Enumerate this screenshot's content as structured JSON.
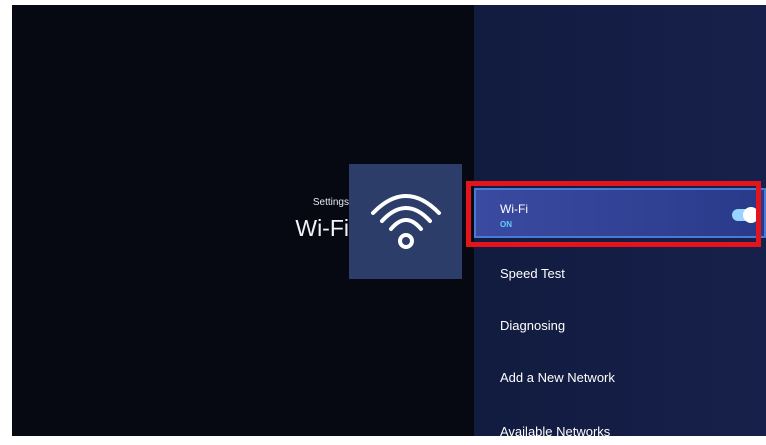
{
  "header": {
    "breadcrumb": "Settings",
    "title": "Wi-Fi"
  },
  "menu": {
    "items": [
      {
        "label": "Wi-Fi",
        "status": "ON",
        "selected": true,
        "toggle_on": true
      },
      {
        "label": "Speed Test"
      },
      {
        "label": "Diagnosing"
      },
      {
        "label": "Add a New Network"
      },
      {
        "label": "Available Networks"
      }
    ]
  },
  "colors": {
    "left_bg": "#060912",
    "right_bg": "#16204a",
    "tile_bg": "#2c3d6a",
    "highlight_red": "#e3141b",
    "status_cyan": "#5fd0ff"
  },
  "icons": {
    "tile": "wifi-icon"
  }
}
